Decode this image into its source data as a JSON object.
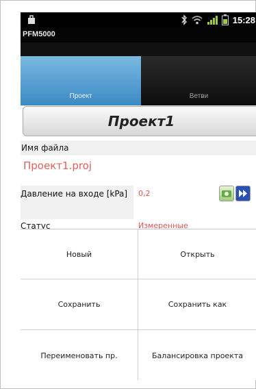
{
  "status_bar": {
    "time": "15:28",
    "icons": [
      "bag-icon",
      "bluetooth-icon",
      "wifi-icon",
      "signal-icon",
      "battery-icon"
    ]
  },
  "app": {
    "title": "PFM5000"
  },
  "tabs": [
    {
      "label": "Проект",
      "active": true
    },
    {
      "label": "Ветви",
      "active": false
    }
  ],
  "project": {
    "title_button": "Проект1",
    "file_label": "Имя файла",
    "file_value": "Проект1.proj",
    "pressure_label": "Давление на входе [kPa]",
    "pressure_value": "0,2",
    "status_label": "Статус",
    "status_value": "Измеренные"
  },
  "menu": {
    "new": "Новый",
    "open": "Открыть",
    "save": "Сохранить",
    "save_as": "Сохранить как",
    "rename": "Переименовать пр.",
    "balance": "Балансировка проекта"
  },
  "colors": {
    "tab_active": "#5aa0d6",
    "value_red": "#e05050",
    "file_red": "#e0605a"
  }
}
